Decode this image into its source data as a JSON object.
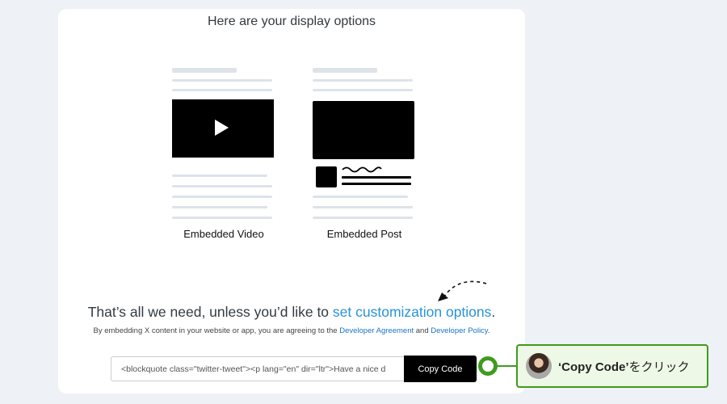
{
  "heading": "Here are your display options",
  "options": {
    "video_label": "Embedded Video",
    "post_label": "Embedded Post"
  },
  "cta": {
    "prefix": "That’s all we need, unless you’d like to ",
    "link": "set customization options",
    "suffix": "."
  },
  "terms": {
    "prefix": "By embedding X content in your website or app, you are agreeing to the ",
    "link1": "Developer Agreement",
    "middle": " and ",
    "link2": "Developer Policy",
    "suffix": "."
  },
  "embed": {
    "code_value": "<blockquote class=\"twitter-tweet\"><p lang=\"en\" dir=\"ltr\">Have a nice d",
    "copy_label": "Copy Code"
  },
  "callout": {
    "bold": "‘Copy Code’",
    "text": "をクリック"
  },
  "colors": {
    "accent_green": "#3e9b1e",
    "link_blue": "#2a93d5"
  }
}
